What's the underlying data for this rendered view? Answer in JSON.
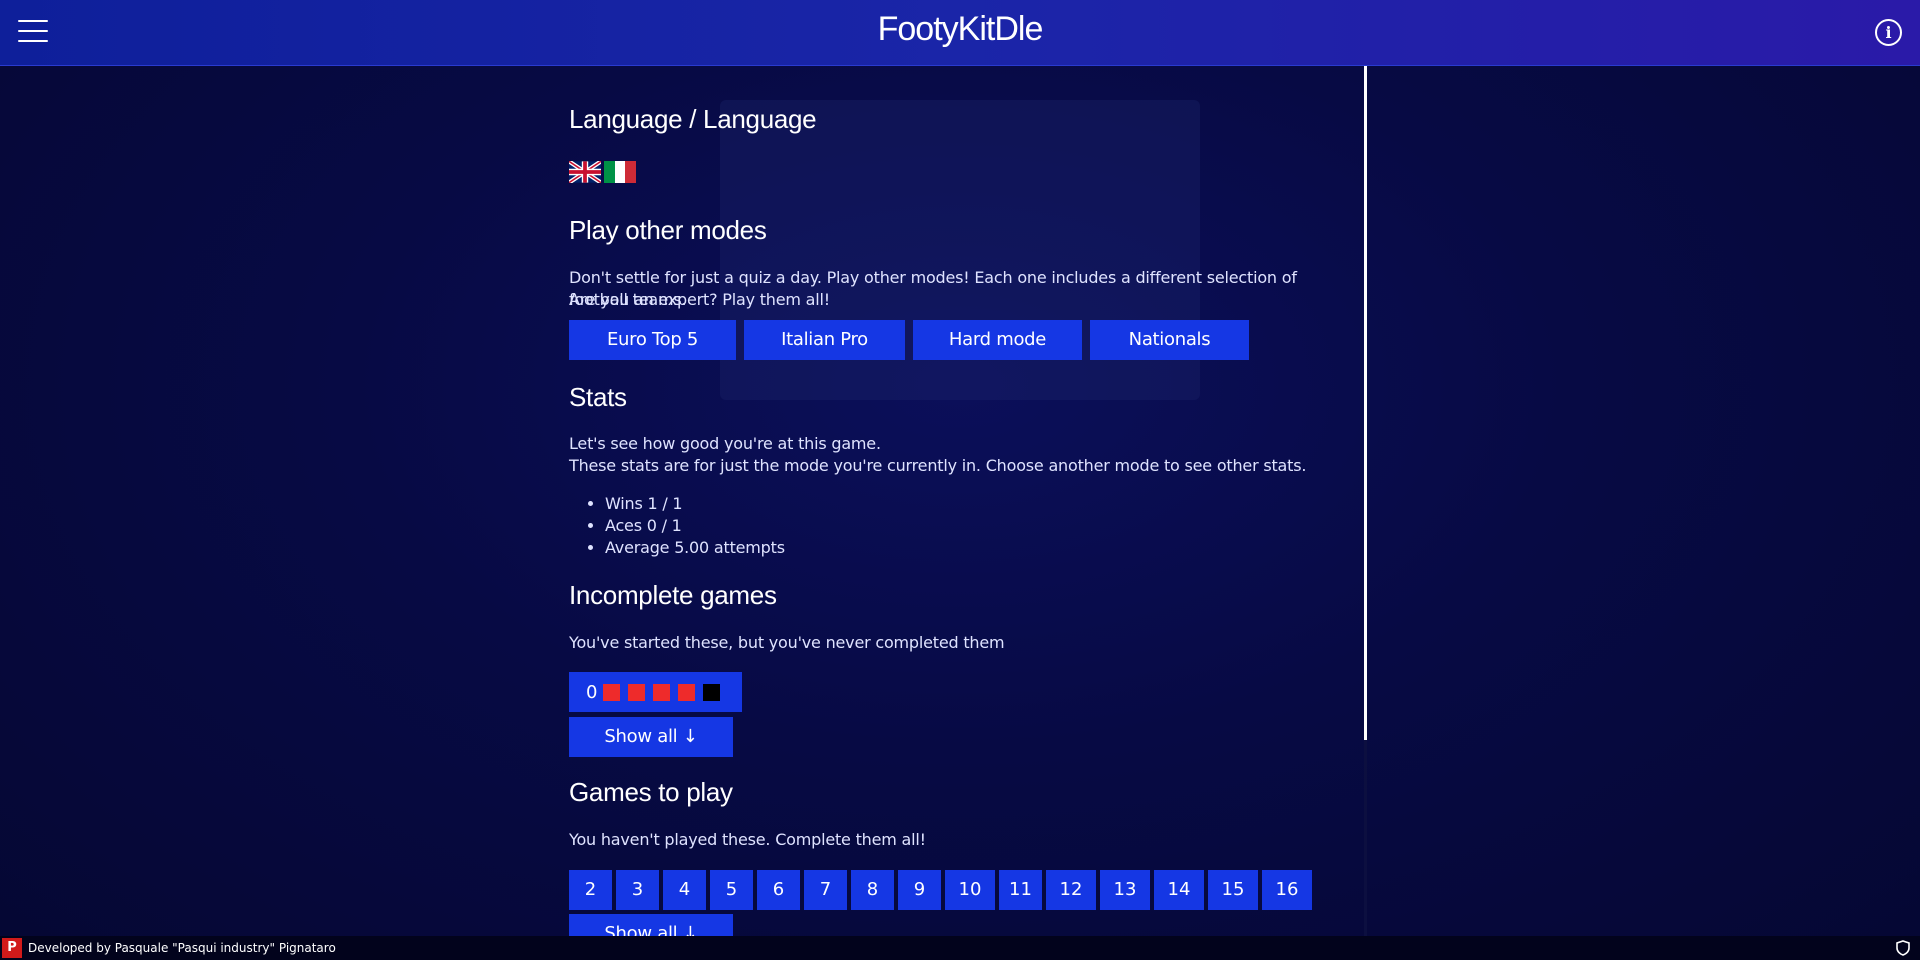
{
  "header": {
    "logo": "FootyKitDle",
    "menu_icon": "hamburger-menu-icon",
    "info_icon": "info-circle-icon",
    "info_glyph": "i"
  },
  "language": {
    "title": "Language / Language",
    "flags": [
      "uk-flag-icon",
      "italy-flag-icon"
    ]
  },
  "modes": {
    "title": "Play other modes",
    "line1": "Don't settle for just a quiz a day. Play other modes! Each one includes a different selection of football teams.",
    "line2": "Are you an expert? Play them all!",
    "buttons": [
      "Euro Top 5",
      "Italian Pro",
      "Hard mode",
      "Nationals"
    ]
  },
  "stats": {
    "title": "Stats",
    "line1": "Let's see how good you're at this game.",
    "line2": "These stats are for just the mode you're currently in. Choose another mode to see other stats.",
    "items": [
      "Wins 1 / 1",
      "Aces 0 / 1",
      "Average 5.00 attempts"
    ]
  },
  "incomplete": {
    "title": "Incomplete games",
    "text": "You've started these, but you've never completed them",
    "game_number": "0",
    "squares": [
      "#ee2b2b",
      "#ee2b2b",
      "#ee2b2b",
      "#ee2b2b",
      "#000000"
    ],
    "show_all": "Show all ↓"
  },
  "to_play": {
    "title": "Games to play",
    "text": "You haven't played these. Complete them all!",
    "games": [
      "2",
      "3",
      "4",
      "5",
      "6",
      "7",
      "8",
      "9",
      "10",
      "11",
      "12",
      "13",
      "14",
      "15",
      "16"
    ],
    "show_all": "Show all ↓"
  },
  "footer": {
    "logo_letter": "P",
    "credit": "Developed by Pasquale \"Pasqui industry\" Pignataro",
    "shield_icon": "shield-icon"
  },
  "colors": {
    "accent": "#1537e4",
    "background": "#070a44",
    "header": "#1a25a8"
  }
}
